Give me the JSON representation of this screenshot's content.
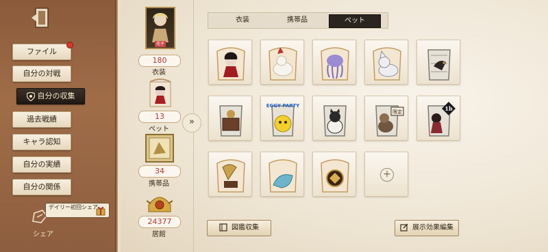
{
  "sidebar": {
    "items": [
      {
        "label": "ファイル",
        "notify": true
      },
      {
        "label": "自分の対戦"
      },
      {
        "label": "自分の収集",
        "active": true
      },
      {
        "label": "過去戦績"
      },
      {
        "label": "キャラ認知"
      },
      {
        "label": "自分の実績"
      },
      {
        "label": "自分の関係"
      }
    ],
    "share_label": "シェア",
    "daily_bubble": "デイリー初回シェア"
  },
  "stats": {
    "portrait_caption": "花子",
    "costume": {
      "count": "180",
      "label": "衣装"
    },
    "pet": {
      "count": "13",
      "label": "ペット"
    },
    "accessory": {
      "count": "34",
      "label": "携帯品"
    },
    "residence": {
      "count": "24377",
      "label": "居館"
    }
  },
  "tabs": [
    {
      "label": "衣装"
    },
    {
      "label": "携帯品"
    },
    {
      "label": "ペット",
      "active": true
    }
  ],
  "grid": {
    "row1": [
      "pet-bat-girl",
      "pet-white-fox",
      "pet-jellyfish",
      "pet-white-wolf",
      "pet-black-bird"
    ],
    "row2": [
      "pet-music-box",
      "pet-eggy-party",
      "pet-cat",
      "pet-dog-limited",
      "pet-doll-1b"
    ],
    "row3": [
      "pet-gramophone",
      "pet-blue-cat",
      "pet-golden-bird",
      "add-slot"
    ],
    "badges": {
      "eggy": "EGGY PARTY",
      "limited": "限定",
      "doll": "1b"
    }
  },
  "buttons": {
    "catalog": "図鑑収集",
    "display_edit": "展示効果編集"
  }
}
